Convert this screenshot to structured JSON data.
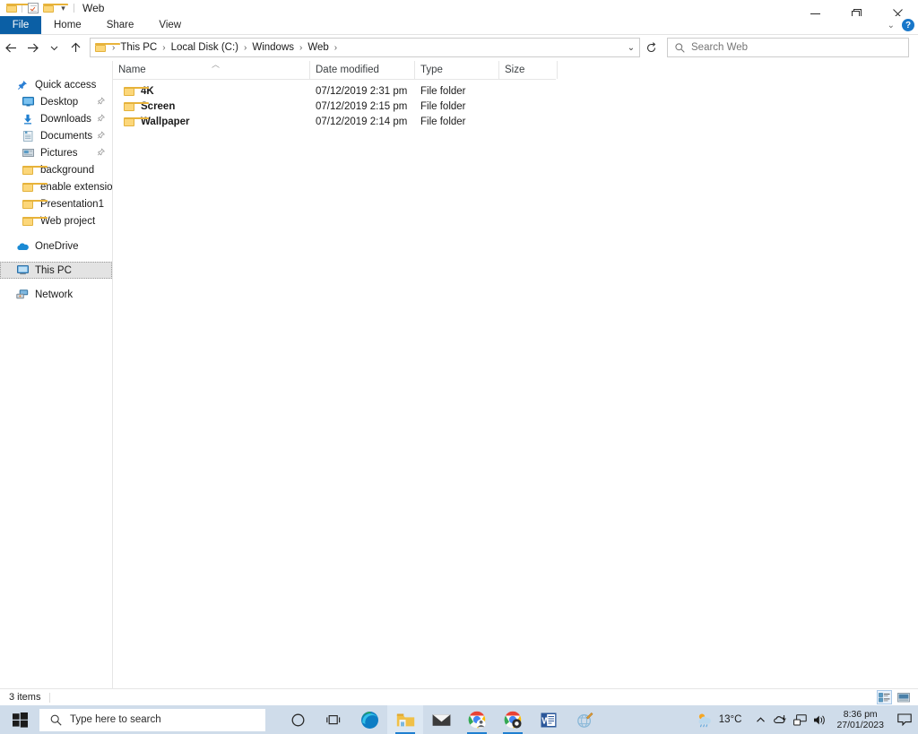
{
  "window": {
    "title": "Web",
    "quick_access_toolbar": [
      {
        "name": "folder-icon",
        "label": ""
      },
      {
        "name": "properties-icon",
        "label": ""
      },
      {
        "name": "new-folder-icon",
        "label": ""
      },
      {
        "name": "customize-quick-access-caret",
        "label": "▾"
      }
    ],
    "controls": {
      "minimize": "Minimize",
      "restore": "Restore Down",
      "close": "Close",
      "ribbon_collapse": "⌄",
      "help": "?"
    }
  },
  "ribbon": {
    "tabs": [
      {
        "label": "File",
        "active": true
      },
      {
        "label": "Home",
        "active": false
      },
      {
        "label": "Share",
        "active": false
      },
      {
        "label": "View",
        "active": false
      }
    ]
  },
  "address_bar": {
    "back_title": "Back",
    "forward_title": "Forward",
    "recent_title": "Recent locations",
    "up_title": "Up",
    "breadcrumbs": [
      "This PC",
      "Local Disk (C:)",
      "Windows",
      "Web"
    ],
    "separator": "›",
    "dropdown": "⌄",
    "refresh_title": "Refresh"
  },
  "search": {
    "placeholder": "Search Web"
  },
  "nav_pane": {
    "items": [
      {
        "label": "Quick access",
        "icon": "pin-icon",
        "indent": false,
        "pinned": false,
        "selected": false
      },
      {
        "label": "Desktop",
        "icon": "desktop-icon",
        "indent": true,
        "pinned": true,
        "selected": false
      },
      {
        "label": "Downloads",
        "icon": "downloads-icon",
        "indent": true,
        "pinned": true,
        "selected": false
      },
      {
        "label": "Documents",
        "icon": "documents-icon",
        "indent": true,
        "pinned": true,
        "selected": false
      },
      {
        "label": "Pictures",
        "icon": "pictures-icon",
        "indent": true,
        "pinned": true,
        "selected": false
      },
      {
        "label": "background",
        "icon": "folder-icon",
        "indent": true,
        "pinned": false,
        "selected": false
      },
      {
        "label": "enable extension",
        "icon": "folder-icon",
        "indent": true,
        "pinned": false,
        "selected": false
      },
      {
        "label": "Presentation1",
        "icon": "folder-icon",
        "indent": true,
        "pinned": false,
        "selected": false
      },
      {
        "label": "Web project",
        "icon": "folder-icon",
        "indent": true,
        "pinned": false,
        "selected": false
      },
      {
        "label": "OneDrive",
        "icon": "onedrive-icon",
        "indent": false,
        "pinned": false,
        "selected": false
      },
      {
        "label": "This PC",
        "icon": "this-pc-icon",
        "indent": false,
        "pinned": false,
        "selected": true
      },
      {
        "label": "Network",
        "icon": "network-icon",
        "indent": false,
        "pinned": false,
        "selected": false
      }
    ]
  },
  "file_list": {
    "columns": [
      "Name",
      "Date modified",
      "Type",
      "Size"
    ],
    "sort": {
      "column": "Name",
      "direction": "ascending",
      "glyph": "︿"
    },
    "rows": [
      {
        "name": "4K",
        "date_modified": "07/12/2019 2:31 pm",
        "type": "File folder",
        "size": ""
      },
      {
        "name": "Screen",
        "date_modified": "07/12/2019 2:15 pm",
        "type": "File folder",
        "size": ""
      },
      {
        "name": "Wallpaper",
        "date_modified": "07/12/2019 2:14 pm",
        "type": "File folder",
        "size": ""
      }
    ]
  },
  "status_bar": {
    "item_count": "3 items",
    "views": [
      {
        "name": "details-view-button",
        "label": "Details view",
        "active": true
      },
      {
        "name": "large-icons-view-button",
        "label": "Large icons view",
        "active": false
      }
    ]
  },
  "taskbar": {
    "start_label": "Start",
    "search_placeholder": "Type here to search",
    "items": [
      {
        "name": "cortana-icon",
        "label": "Cortana",
        "active": false,
        "running": false
      },
      {
        "name": "task-view-icon",
        "label": "Task View",
        "active": false,
        "running": false
      },
      {
        "name": "edge-icon",
        "label": "Microsoft Edge",
        "active": false,
        "running": false
      },
      {
        "name": "file-explorer-icon",
        "label": "File Explorer",
        "active": true,
        "running": true
      },
      {
        "name": "mail-icon",
        "label": "Mail",
        "active": false,
        "running": false
      },
      {
        "name": "chrome-profile-icon",
        "label": "Google Chrome",
        "active": false,
        "running": true
      },
      {
        "name": "chrome-icon",
        "label": "Google Chrome",
        "active": false,
        "running": true
      },
      {
        "name": "word-icon",
        "label": "Microsoft Word",
        "active": false,
        "running": true
      },
      {
        "name": "paint3d-icon",
        "label": "Paint 3D",
        "active": false,
        "running": false
      }
    ],
    "tray": {
      "weather_temp": "13°C",
      "weather_icon": "partly-sunny-rain-icon",
      "show_hidden": "⌃",
      "icons": [
        {
          "name": "onedrive-tray-icon",
          "label": "OneDrive"
        },
        {
          "name": "network-tray-icon",
          "label": "Network"
        },
        {
          "name": "volume-tray-icon",
          "label": "Volume"
        }
      ],
      "time": "8:36 pm",
      "date": "27/01/2023",
      "notifications": "Notifications"
    }
  },
  "colors": {
    "accent_blue": "#0b5fa5",
    "folder_yellow": "#fcd77a",
    "taskbar": "#cfdcea",
    "selection_gray": "#e3e3e3"
  }
}
